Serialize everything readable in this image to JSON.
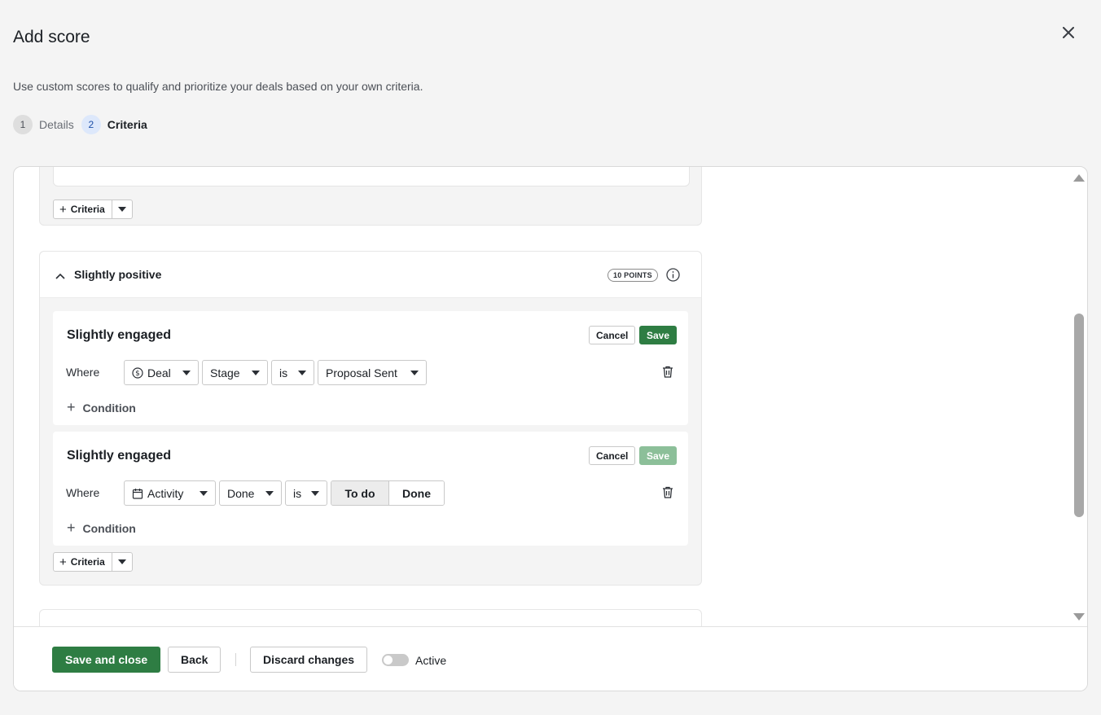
{
  "dialog": {
    "title": "Add score",
    "subtitle": "Use custom scores to qualify and prioritize your deals based on your own criteria."
  },
  "stepper": {
    "steps": [
      {
        "number": "1",
        "label": "Details",
        "state": "inactive"
      },
      {
        "number": "2",
        "label": "Criteria",
        "state": "active"
      }
    ]
  },
  "top_group": {
    "criteria_button": "Criteria"
  },
  "group": {
    "title": "Slightly positive",
    "points_badge": "10 POINTS",
    "criteria_button": "Criteria",
    "criteria": [
      {
        "title": "Slightly engaged",
        "cancel_label": "Cancel",
        "save_label": "Save",
        "save_enabled": true,
        "where_label": "Where",
        "entity": {
          "label": "Deal",
          "icon": "dollar-circle-icon"
        },
        "field": "Stage",
        "operator": "is",
        "value": "Proposal Sent",
        "condition_label": "Condition"
      },
      {
        "title": "Slightly engaged",
        "cancel_label": "Cancel",
        "save_label": "Save",
        "save_enabled": false,
        "where_label": "Where",
        "entity": {
          "label": "Activity",
          "icon": "calendar-icon"
        },
        "field": "Done",
        "operator": "is",
        "segmented": {
          "options": [
            "To do",
            "Done"
          ],
          "selected": "To do"
        },
        "condition_label": "Condition"
      }
    ]
  },
  "footer": {
    "save_close": "Save and close",
    "back": "Back",
    "discard": "Discard changes",
    "active_label": "Active",
    "active_on": false
  },
  "colors": {
    "primary": "#2e7d43",
    "primary_disabled": "#8cbf99",
    "background": "#f4f4f4",
    "step_active_bg": "#dde8fb"
  }
}
